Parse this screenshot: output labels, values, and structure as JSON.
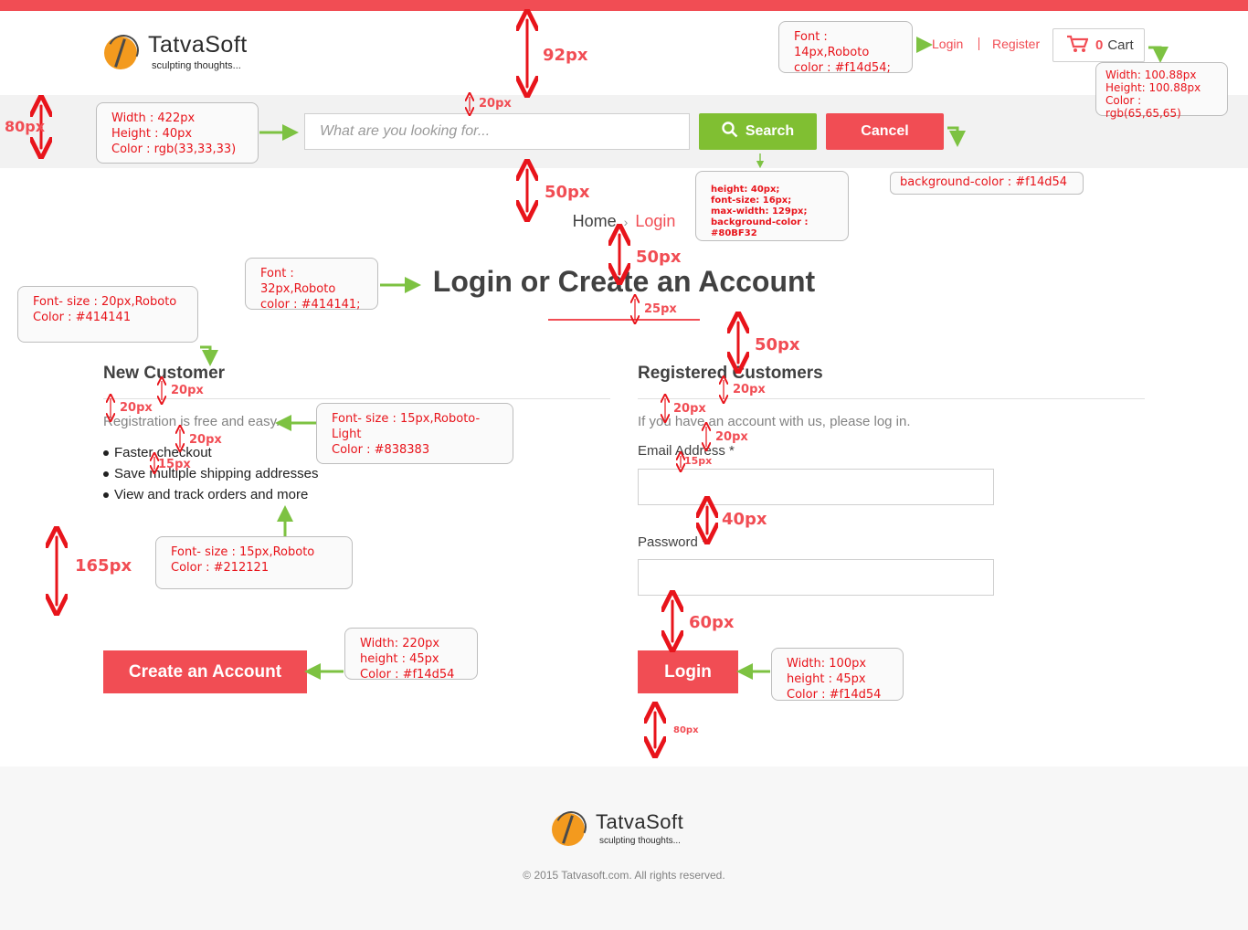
{
  "header": {
    "brand": "TatvaSoft",
    "tagline": "sculpting thoughts...",
    "login_label": "Login",
    "register_label": "Register",
    "cart_count": "0",
    "cart_label": "Cart"
  },
  "search": {
    "placeholder": "What are you looking for...",
    "search_label": "Search",
    "cancel_label": "Cancel"
  },
  "breadcrumb": {
    "home": "Home",
    "separator": "›",
    "current": "Login"
  },
  "page_title": "Login or Create an Account",
  "new_customer": {
    "title": "New Customer",
    "intro": "Registration is free and easy.",
    "benefits": [
      "Faster checkout",
      "Save multiple shipping addresses",
      "View and track orders and more"
    ],
    "button": "Create an Account"
  },
  "registered": {
    "title": "Registered Customers",
    "intro": "If you have an account with us, please log in.",
    "email_label": "Email Address *",
    "password_label": "Password *",
    "button": "Login"
  },
  "footer": {
    "brand": "TatvaSoft",
    "tagline": "sculpting thoughts...",
    "copyright": "© 2015 Tatvasoft.com. All rights reserved."
  },
  "annotations": {
    "header_font": "Font : 14px,Roboto\ncolor : #f14d54;",
    "cart_size": "Width:  100.88px\nHeight:  100.88px\nColor : rgb(65,65,65)",
    "search_size": "Width :  422px\nHeight :  40px\nColor : rgb(33,33,33)",
    "search_btn": "height: 40px;\nfont-size: 16px;\nmax-width: 129px;\nbackground-color : #80BF32",
    "cancel_bg": "background-color : #f14d54",
    "title_font": "Font : 32px,Roboto\ncolor : #414141;",
    "col_title_font": "Font- size :  20px,Roboto\nColor : #414141",
    "intro_font": "Font- size :  15px,Roboto-Light\nColor : #838383",
    "list_font": "Font- size :  15px,Roboto\nColor : #212121",
    "create_btn": "Width:  220px\nheight : 45px\nColor : #f14d54",
    "login_btn": "Width:  100px\nheight : 45px\nColor : #f14d54",
    "d92": "92px",
    "d20a": "20px",
    "d80": "80px",
    "d50a": "50px",
    "d50b": "50px",
    "d25": "25px",
    "d50c": "50px",
    "d20b": "20px",
    "d20c": "20px",
    "d20d": "20px",
    "d15a": "15px",
    "d20e": "20px",
    "d20f": "20px",
    "d20g": "20px",
    "d15b": "15px",
    "d40": "40px",
    "d60": "60px",
    "d165": "165px",
    "d80b": "80px"
  }
}
